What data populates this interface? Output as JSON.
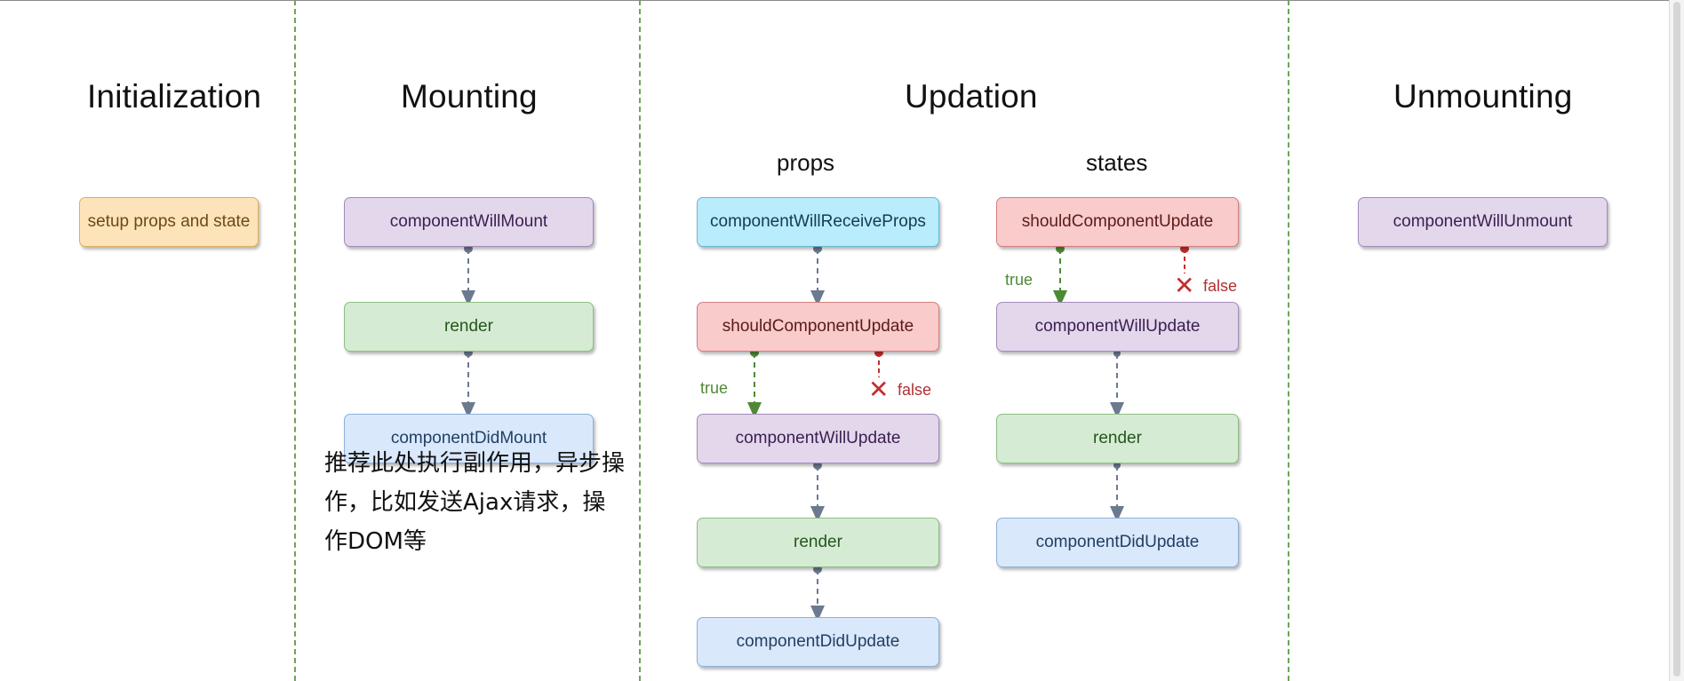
{
  "sections": {
    "initialization": "Initialization",
    "mounting": "Mounting",
    "updation": "Updation",
    "unmounting": "Unmounting"
  },
  "updation_subsections": {
    "props": "props",
    "states": "states"
  },
  "initialization": {
    "setup": "setup props and state"
  },
  "mounting": {
    "will_mount": "componentWillMount",
    "render": "render",
    "did_mount": "componentDidMount",
    "note": "推荐此处执行副作用，异步操作，比如发送Ajax请求，操作DOM等"
  },
  "props_flow": {
    "will_receive_props": "componentWillReceiveProps",
    "should_update": "shouldComponentUpdate",
    "true_label": "true",
    "false_label": "false",
    "will_update": "componentWillUpdate",
    "render": "render",
    "did_update": "componentDidUpdate"
  },
  "states_flow": {
    "should_update": "shouldComponentUpdate",
    "true_label": "true",
    "false_label": "false",
    "will_update": "componentWillUpdate",
    "render": "render",
    "did_update": "componentDidUpdate"
  },
  "unmounting": {
    "will_unmount": "componentWillUnmount"
  },
  "colors": {
    "divider": "#6ca55a",
    "arrow_neutral": "#6b7a8f",
    "arrow_true": "#4e8a35",
    "arrow_false": "#c42d2d"
  }
}
